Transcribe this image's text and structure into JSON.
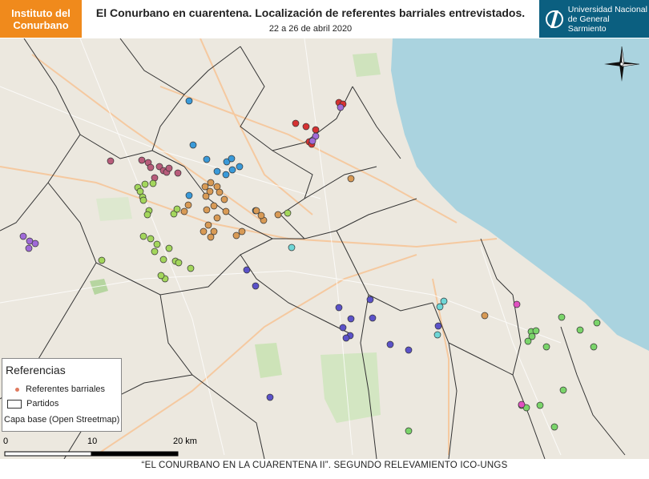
{
  "header": {
    "logo_left_line1": "Instituto del",
    "logo_left_line2": "Conurbano",
    "title": "El Conurbano en cuarentena. Localización de referentes barriales entrevistados.",
    "subtitle": "22 a 26 de abril 2020",
    "logo_right_line1": "Universidad Nacional",
    "logo_right_line2": "de General Sarmiento"
  },
  "legend": {
    "title": "Referencias",
    "item_points": "Referentes barriales",
    "item_partidos": "Partidos",
    "base": "Capa base (Open Streetmap)"
  },
  "scale": {
    "label_0": "0",
    "label_10": "10",
    "label_20": "20 km"
  },
  "footer": "“EL CONURBANO EN LA CUARENTENA II”. SEGUNDO RELEVAMIENTO ICO-UNGS",
  "icons": {
    "north_arrow": "compass-rose-icon"
  },
  "colors": {
    "brand_orange": "#f08a1c",
    "brand_blue": "#0b5f80",
    "river": "#aad3df",
    "land": "#ece8df"
  },
  "points": [
    {
      "c": "#3a9ad9",
      "p": [
        [
          236,
          78
        ],
        [
          241,
          133
        ],
        [
          258,
          151
        ],
        [
          283,
          154
        ],
        [
          299,
          160
        ],
        [
          290,
          164
        ],
        [
          289,
          150
        ],
        [
          271,
          166
        ],
        [
          282,
          170
        ],
        [
          236,
          196
        ],
        [
          319,
          215
        ]
      ]
    },
    {
      "c": "#b85c7b",
      "p": [
        [
          177,
          152
        ],
        [
          185,
          155
        ],
        [
          188,
          161
        ],
        [
          199,
          160
        ],
        [
          204,
          165
        ],
        [
          208,
          167
        ],
        [
          211,
          162
        ],
        [
          222,
          168
        ],
        [
          193,
          174
        ],
        [
          138,
          153
        ]
      ]
    },
    {
      "c": "#a3d65c",
      "p": [
        [
          172,
          186
        ],
        [
          175,
          191
        ],
        [
          181,
          182
        ],
        [
          178,
          198
        ],
        [
          191,
          181
        ],
        [
          179,
          202
        ],
        [
          186,
          215
        ],
        [
          184,
          220
        ],
        [
          217,
          219
        ],
        [
          221,
          213
        ],
        [
          179,
          247
        ],
        [
          188,
          250
        ],
        [
          196,
          257
        ],
        [
          193,
          266
        ],
        [
          204,
          276
        ],
        [
          219,
          278
        ],
        [
          211,
          262
        ],
        [
          223,
          280
        ],
        [
          238,
          287
        ],
        [
          206,
          300
        ],
        [
          201,
          296
        ],
        [
          127,
          277
        ],
        [
          359,
          218
        ]
      ]
    },
    {
      "c": "#d89a55",
      "p": [
        [
          256,
          185
        ],
        [
          263,
          180
        ],
        [
          271,
          185
        ],
        [
          274,
          192
        ],
        [
          262,
          191
        ],
        [
          257,
          197
        ],
        [
          280,
          201
        ],
        [
          267,
          209
        ],
        [
          258,
          214
        ],
        [
          235,
          208
        ],
        [
          230,
          216
        ],
        [
          271,
          224
        ],
        [
          282,
          216
        ],
        [
          260,
          233
        ],
        [
          267,
          241
        ],
        [
          254,
          241
        ],
        [
          263,
          248
        ],
        [
          302,
          241
        ],
        [
          295,
          246
        ],
        [
          320,
          215
        ],
        [
          329,
          227
        ],
        [
          326,
          221
        ],
        [
          347,
          220
        ],
        [
          438,
          175
        ],
        [
          605,
          346
        ]
      ]
    },
    {
      "c": "#d63232",
      "p": [
        [
          369,
          106
        ],
        [
          382,
          110
        ],
        [
          394,
          114
        ],
        [
          386,
          129
        ],
        [
          389,
          132
        ],
        [
          423,
          80
        ],
        [
          428,
          82
        ]
      ]
    },
    {
      "c": "#a06bd8",
      "p": [
        [
          394,
          122
        ],
        [
          390,
          128
        ],
        [
          425,
          86
        ],
        [
          37,
          253
        ],
        [
          29,
          247
        ],
        [
          36,
          262
        ],
        [
          44,
          256
        ]
      ]
    },
    {
      "c": "#5b52c8",
      "p": [
        [
          308,
          289
        ],
        [
          319,
          309
        ],
        [
          423,
          336
        ],
        [
          438,
          350
        ],
        [
          428,
          361
        ],
        [
          437,
          371
        ],
        [
          432,
          374
        ],
        [
          462,
          326
        ],
        [
          465,
          349
        ],
        [
          337,
          448
        ],
        [
          487,
          382
        ],
        [
          510,
          389
        ],
        [
          547,
          359
        ]
      ]
    },
    {
      "c": "#6fd6d6",
      "p": [
        [
          554,
          328
        ],
        [
          549,
          335
        ],
        [
          546,
          370
        ],
        [
          364,
          261
        ]
      ]
    },
    {
      "c": "#7ad46a",
      "p": [
        [
          663,
          366
        ],
        [
          669,
          365
        ],
        [
          664,
          372
        ],
        [
          659,
          378
        ],
        [
          701,
          348
        ],
        [
          724,
          364
        ],
        [
          745,
          355
        ],
        [
          741,
          385
        ],
        [
          682,
          385
        ],
        [
          703,
          439
        ],
        [
          651,
          458
        ],
        [
          674,
          458
        ],
        [
          692,
          485
        ],
        [
          510,
          490
        ],
        [
          657,
          461
        ]
      ]
    },
    {
      "c": "#e051c0",
      "p": [
        [
          645,
          332
        ],
        [
          651,
          457
        ]
      ]
    }
  ]
}
